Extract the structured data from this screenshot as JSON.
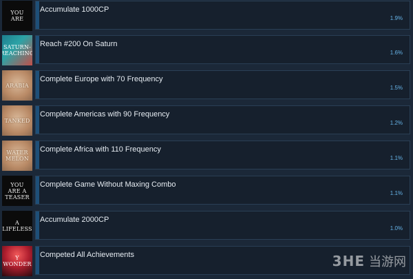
{
  "achievements": [
    {
      "title": "Accumulate 1000CP",
      "percent": "1.9%",
      "icon_text": "YOU ARE",
      "icon_style": "dark"
    },
    {
      "title": "Reach #200 On Saturn",
      "percent": "1.6%",
      "icon_text": "SATURN-REACHING",
      "icon_style": "teal"
    },
    {
      "title": "Complete Europe with 70 Frequency",
      "percent": "1.5%",
      "icon_text": "ARABIA",
      "icon_style": "paper"
    },
    {
      "title": "Complete Americas with 90 Frequency",
      "percent": "1.2%",
      "icon_text": "TANKED",
      "icon_style": "paper"
    },
    {
      "title": "Complete Africa with 110 Frequency",
      "percent": "1.1%",
      "icon_text": "WATER MELON",
      "icon_style": "paper"
    },
    {
      "title": "Complete Game Without Maxing Combo",
      "percent": "1.1%",
      "icon_text": "YOU ARE A TEASER",
      "icon_style": "dark"
    },
    {
      "title": "Accumulate 2000CP",
      "percent": "1.0%",
      "icon_text": "A LIFELESS",
      "icon_style": "dark"
    },
    {
      "title": "Competed All Achievements",
      "percent": "",
      "icon_text": "Y WONDER",
      "icon_style": "fire"
    }
  ],
  "watermark": {
    "logo": "3HE",
    "site": "当游网"
  },
  "colors": {
    "background": "#1b2838",
    "card": "#16202d",
    "border": "#2a3f55",
    "accent": "#1e4f78",
    "percent": "#67b4e8"
  }
}
